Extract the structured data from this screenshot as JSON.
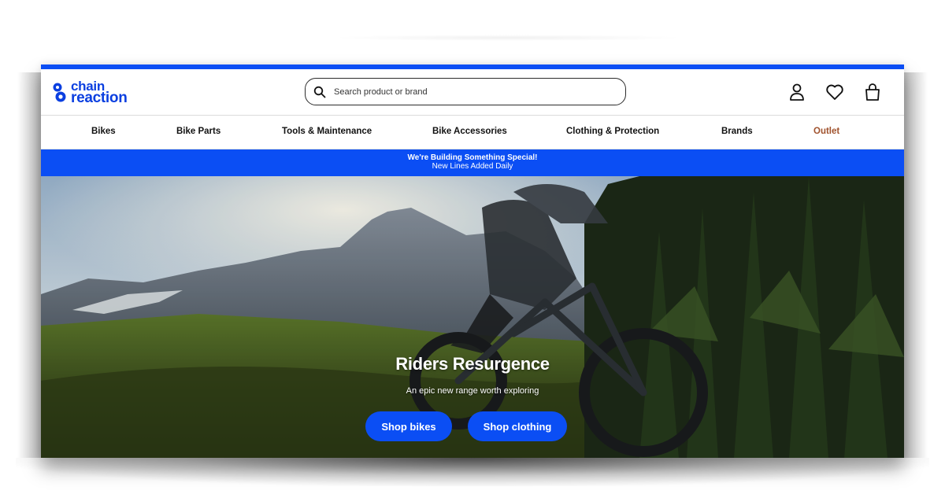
{
  "brand": {
    "logo_line1": "chain",
    "logo_line2": "reaction",
    "color": "#0b4ef4"
  },
  "search": {
    "placeholder": "Search product or brand"
  },
  "header_icons": [
    "account-icon",
    "wishlist-heart-icon",
    "basket-icon"
  ],
  "nav": {
    "items": [
      {
        "label": "Bikes"
      },
      {
        "label": "Bike Parts"
      },
      {
        "label": "Tools & Maintenance"
      },
      {
        "label": "Bike Accessories"
      },
      {
        "label": "Clothing & Protection"
      },
      {
        "label": "Brands"
      },
      {
        "label": "Outlet",
        "color": "#a0522d"
      }
    ]
  },
  "promo": {
    "line1": "We're Building Something Special!",
    "line2": "New Lines Added Daily"
  },
  "hero": {
    "title": "Riders Resurgence",
    "subtitle": "An epic new range worth exploring",
    "buttons": {
      "bikes": "Shop bikes",
      "clothing": "Shop clothing"
    }
  }
}
